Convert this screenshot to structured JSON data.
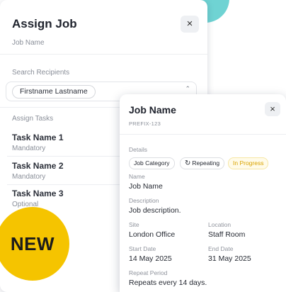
{
  "assign_card": {
    "title": "Assign Job",
    "subtitle": "Job Name",
    "close_label": "×",
    "search_label": "Search Recipients",
    "recipient_chip": "Firstname Lastname",
    "select_icon": "⌃⌄",
    "tasks_label": "Assign Tasks",
    "tasks": [
      {
        "name": "Task Name 1",
        "status": "Mandatory"
      },
      {
        "name": "Task Name 2",
        "status": "Mandatory"
      },
      {
        "name": "Task Name 3",
        "status": "Optional"
      }
    ]
  },
  "job_card": {
    "title": "Job Name",
    "ref": "PREFIX-123",
    "close_label": "×",
    "details_label": "Details",
    "tags": {
      "category": "Job Category",
      "repeating": "Repeating",
      "repeating_icon": "↻",
      "status": "In Progress"
    },
    "name_label": "Name",
    "name_value": "Job Name",
    "description_label": "Description",
    "description_value": "Job description.",
    "site_label": "Site",
    "site_value": "London Office",
    "location_label": "Location",
    "location_value": "Staff Room",
    "start_label": "Start Date",
    "start_value": "14 May 2025",
    "end_label": "End Date",
    "end_value": "31 May 2025",
    "repeat_label": "Repeat Period",
    "repeat_value": "Repeats every 14 days."
  },
  "badge": {
    "label": "NEW"
  },
  "colors": {
    "badge": "#f5c400",
    "decor_circle": "#6fd3d3",
    "in_progress": "#d9a300"
  }
}
